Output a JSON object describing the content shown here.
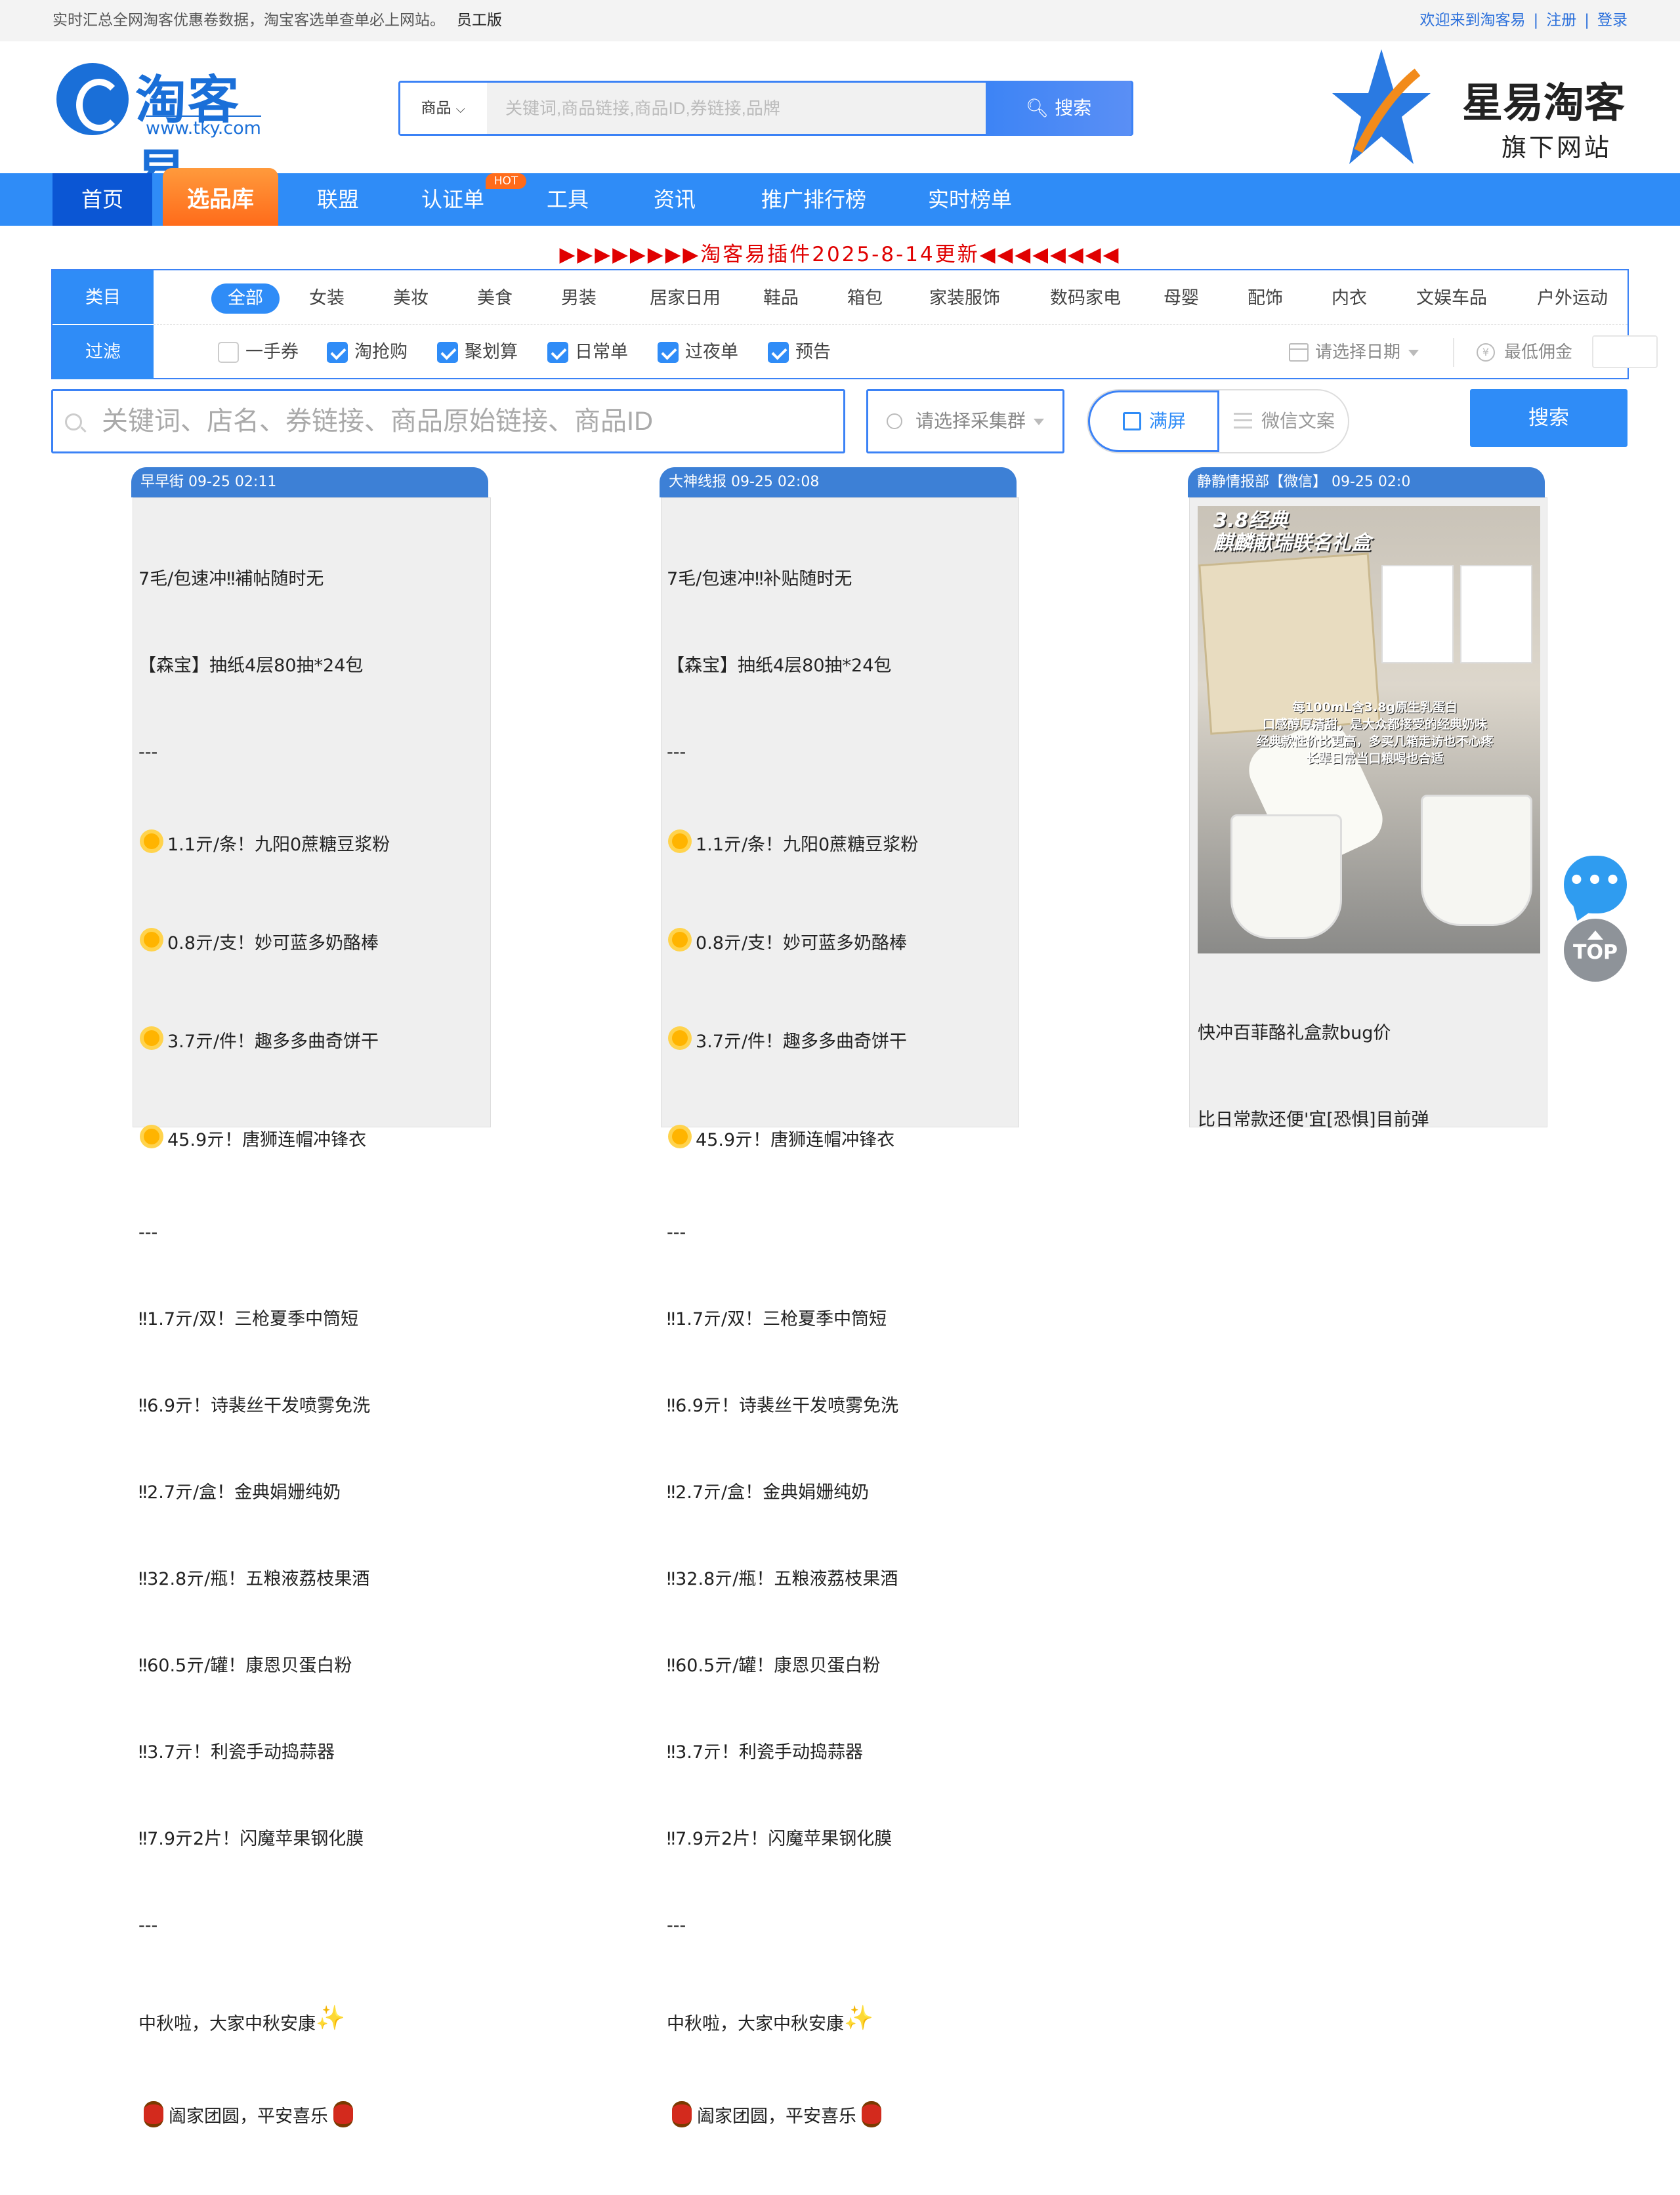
{
  "topbar": {
    "intro": "实时汇总全网淘客优惠卷数据，淘宝客选单查单必上网站。",
    "staff": "员工版",
    "welcome": "欢迎来到淘客易",
    "register": "注册",
    "login": "登录",
    "sep": "|"
  },
  "logo": {
    "name": "淘客易",
    "url": "www.tky.com"
  },
  "search": {
    "category": "商品",
    "placeholder": "关键词,商品链接,商品ID,券链接,品牌",
    "button": "搜索"
  },
  "brand": {
    "title": "星易淘客",
    "sub": "旗下网站",
    "colors": {
      "star": "#2a7ae2",
      "accent": "#f28b1b"
    }
  },
  "nav": {
    "items": [
      "首页",
      "选品库",
      "联盟",
      "认证单",
      "工具",
      "资讯",
      "推广排行榜",
      "实时榜单"
    ],
    "hot_badge": "HOT"
  },
  "notice": "▶▶▶▶▶▶▶▶淘客易插件2025-8-14更新◀◀◀◀◀◀◀◀",
  "filter": {
    "category_label": "类目",
    "filter_label": "过滤",
    "categories": [
      "全部",
      "女装",
      "美妆",
      "美食",
      "男装",
      "居家日用",
      "鞋品",
      "箱包",
      "家装服饰",
      "数码家电",
      "母婴",
      "配饰",
      "内衣",
      "文娱车品",
      "户外运动"
    ],
    "checks": [
      {
        "label": "一手券",
        "checked": false
      },
      {
        "label": "淘抢购",
        "checked": true
      },
      {
        "label": "聚划算",
        "checked": true
      },
      {
        "label": "日常单",
        "checked": true
      },
      {
        "label": "过夜单",
        "checked": true
      },
      {
        "label": "预告",
        "checked": true
      }
    ],
    "date_placeholder": "请选择日期",
    "min_commission": "最低佣金",
    "yen_icon": "¥"
  },
  "search2": {
    "placeholder": "关键词、店名、券链接、商品原始链接、商品ID",
    "group_placeholder": "请选择采集群",
    "fullscreen": "满屏",
    "wechat_copy": "微信文案",
    "button": "搜索"
  },
  "cards": [
    {
      "header": "早早街 09-25 02:11",
      "lines": [
        "7毛/包速冲‼補帖随时无",
        "【森宝】抽纸4层80抽*24包",
        "---",
        "1.1亓/条！九阳0蔗糖豆浆粉",
        "0.8亓/支！妙可蓝多奶酪棒",
        "3.7亓/件！趣多多曲奇饼干",
        "45.9亓！唐狮连帽冲锋衣",
        "---",
        "‼1.7亓/双！三枪夏季中筒短",
        "‼6.9亓！诗裴丝干发喷雾免洗",
        "‼2.7亓/盒！金典娟姗纯奶",
        "‼32.8亓/瓶！五粮液荔枝果酒",
        "‼60.5亓/罐！康恩贝蛋白粉",
        "‼3.7亓！利瓷手动捣蒜器",
        "‼7.9亓2片！闪魔苹果钢化膜",
        "---",
        "中秋啦，大家中秋安康",
        "阖家团圆，平安喜乐"
      ]
    },
    {
      "header": "大神线报 09-25 02:08",
      "lines": [
        "7毛/包速冲‼补贴随时无",
        "【森宝】抽纸4层80抽*24包",
        "---",
        "1.1亓/条！九阳0蔗糖豆浆粉",
        "0.8亓/支！妙可蓝多奶酪棒",
        "3.7亓/件！趣多多曲奇饼干",
        "45.9亓！唐狮连帽冲锋衣",
        "---",
        "‼1.7亓/双！三枪夏季中筒短",
        "‼6.9亓！诗裴丝干发喷雾免洗",
        "‼2.7亓/盒！金典娟姗纯奶",
        "‼32.8亓/瓶！五粮液荔枝果酒",
        "‼60.5亓/罐！康恩贝蛋白粉",
        "‼3.7亓！利瓷手动捣蒜器",
        "‼7.9亓2片！闪魔苹果钢化膜",
        "---",
        "中秋啦，大家中秋安康",
        "阖家团圆，平安喜乐"
      ]
    },
    {
      "header": "静静情报部【微信】 09-25 02:0",
      "photo_text": {
        "headline1": "3.8经典",
        "headline2": "麒麟献瑞联名礼盒",
        "caption1": "每100mL含3.8g原生乳蛋白",
        "caption2": "口感醇厚清甜，是大众都接受的经典奶味",
        "caption3": "经典款性价比更高，多买几箱走访也不心疼",
        "caption4": "长辈日常当口粮喝也合适"
      },
      "lines": [
        "快冲百菲酪礼盒款bug价",
        "比日常款还便'宜[恐惧]目前弹"
      ]
    }
  ],
  "float": {
    "chat_dots": "•••",
    "top": "TOP"
  }
}
